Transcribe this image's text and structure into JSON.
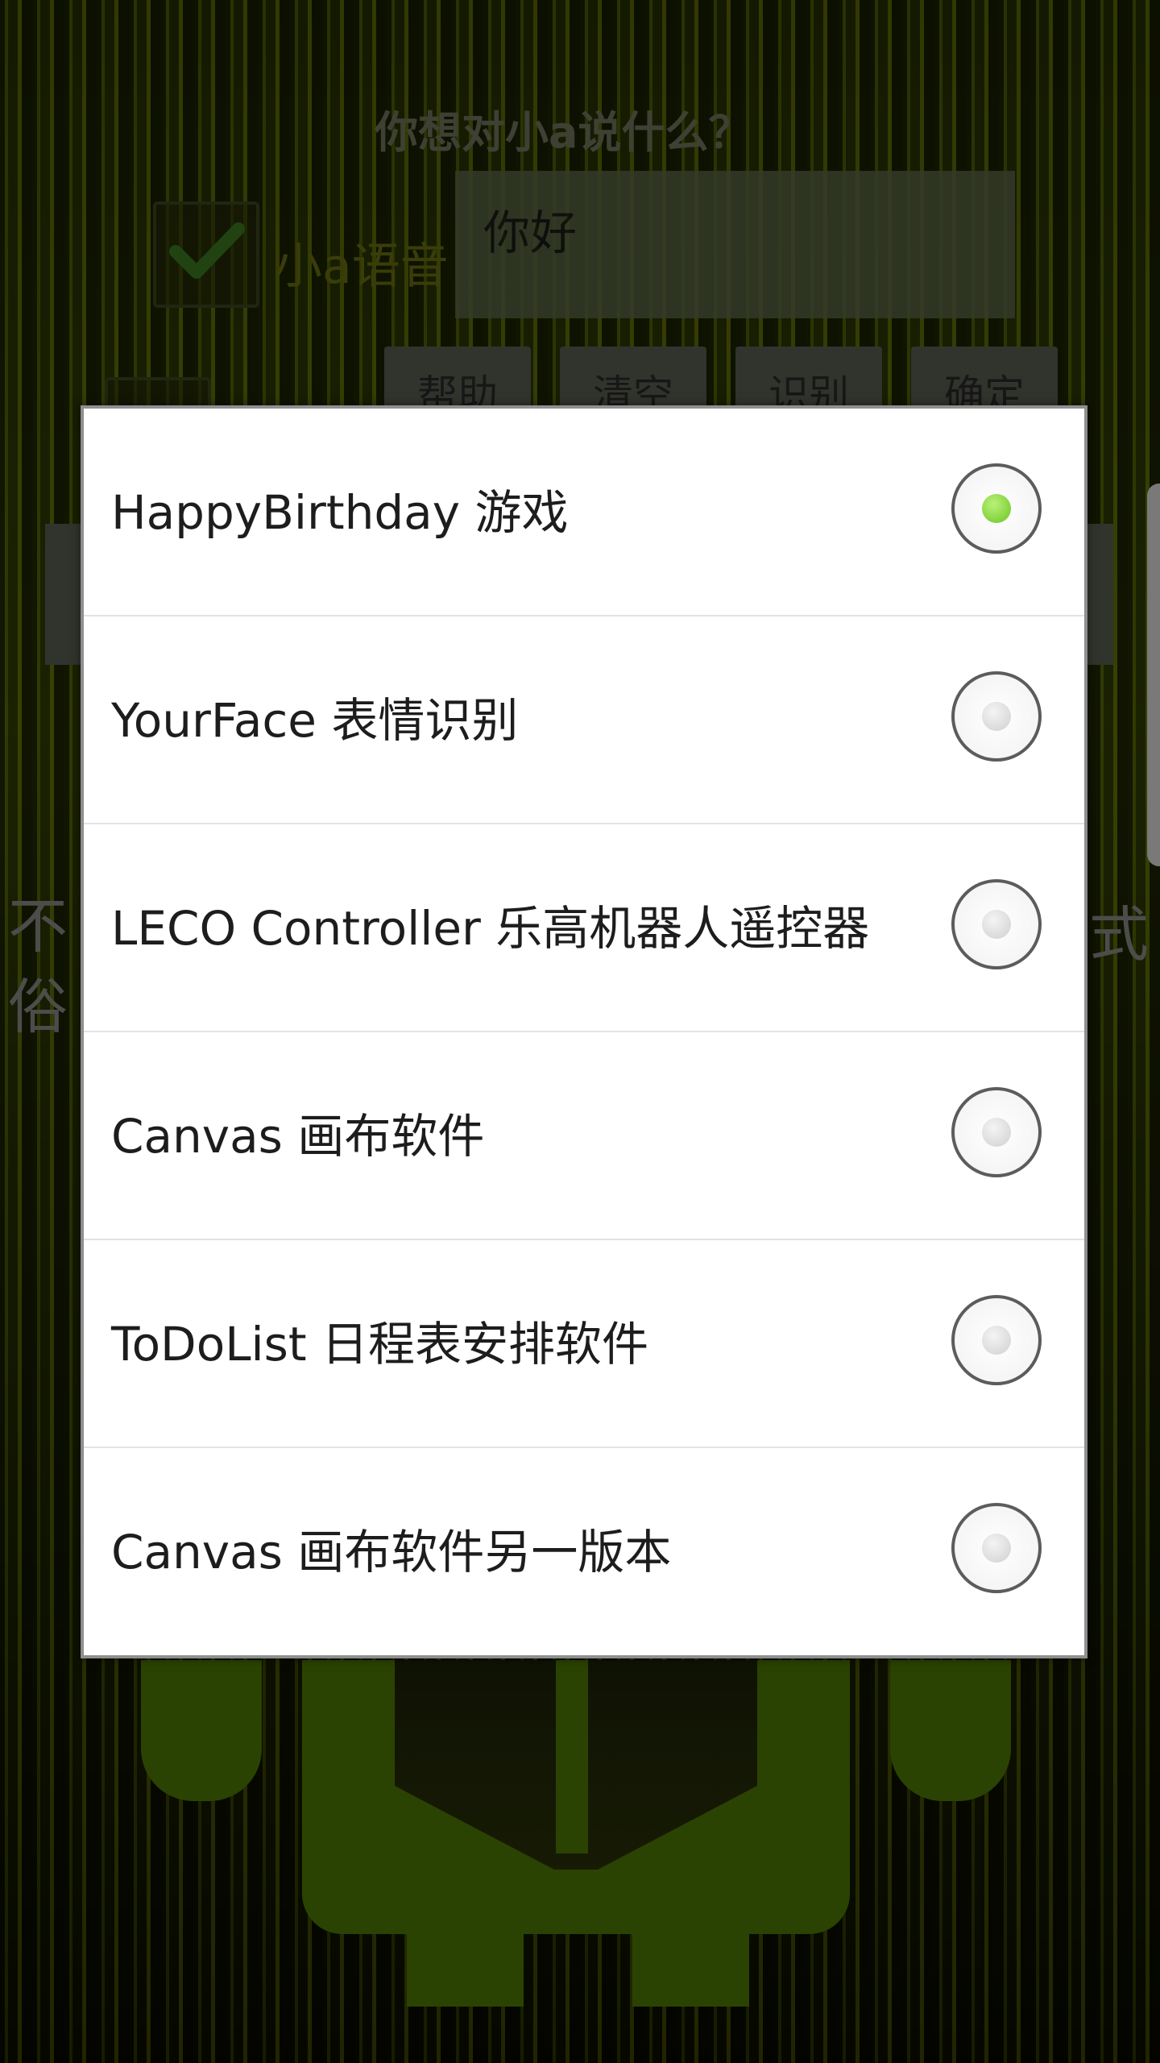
{
  "background": {
    "prompt": "你想对小a说什么？",
    "voice_checkbox": {
      "label": "小a语音",
      "checked": true
    },
    "input": {
      "value": "你好"
    },
    "buttons": [
      "帮助",
      "清空",
      "识别",
      "确定"
    ],
    "side_text_left": "不俗",
    "side_text_right": "式"
  },
  "dialog": {
    "options": [
      {
        "label": "HappyBirthday  游戏",
        "selected": true
      },
      {
        "label": "YourFace 表情识别",
        "selected": false
      },
      {
        "label": "LECO Controller 乐高机器人遥控器",
        "selected": false
      },
      {
        "label": "Canvas 画布软件",
        "selected": false
      },
      {
        "label": "ToDoList 日程表安排软件",
        "selected": false
      },
      {
        "label": "Canvas 画布软件另一版本",
        "selected": false
      }
    ]
  },
  "colors": {
    "accent_selected": "#6cc322",
    "background_green": "#4d5f08"
  }
}
